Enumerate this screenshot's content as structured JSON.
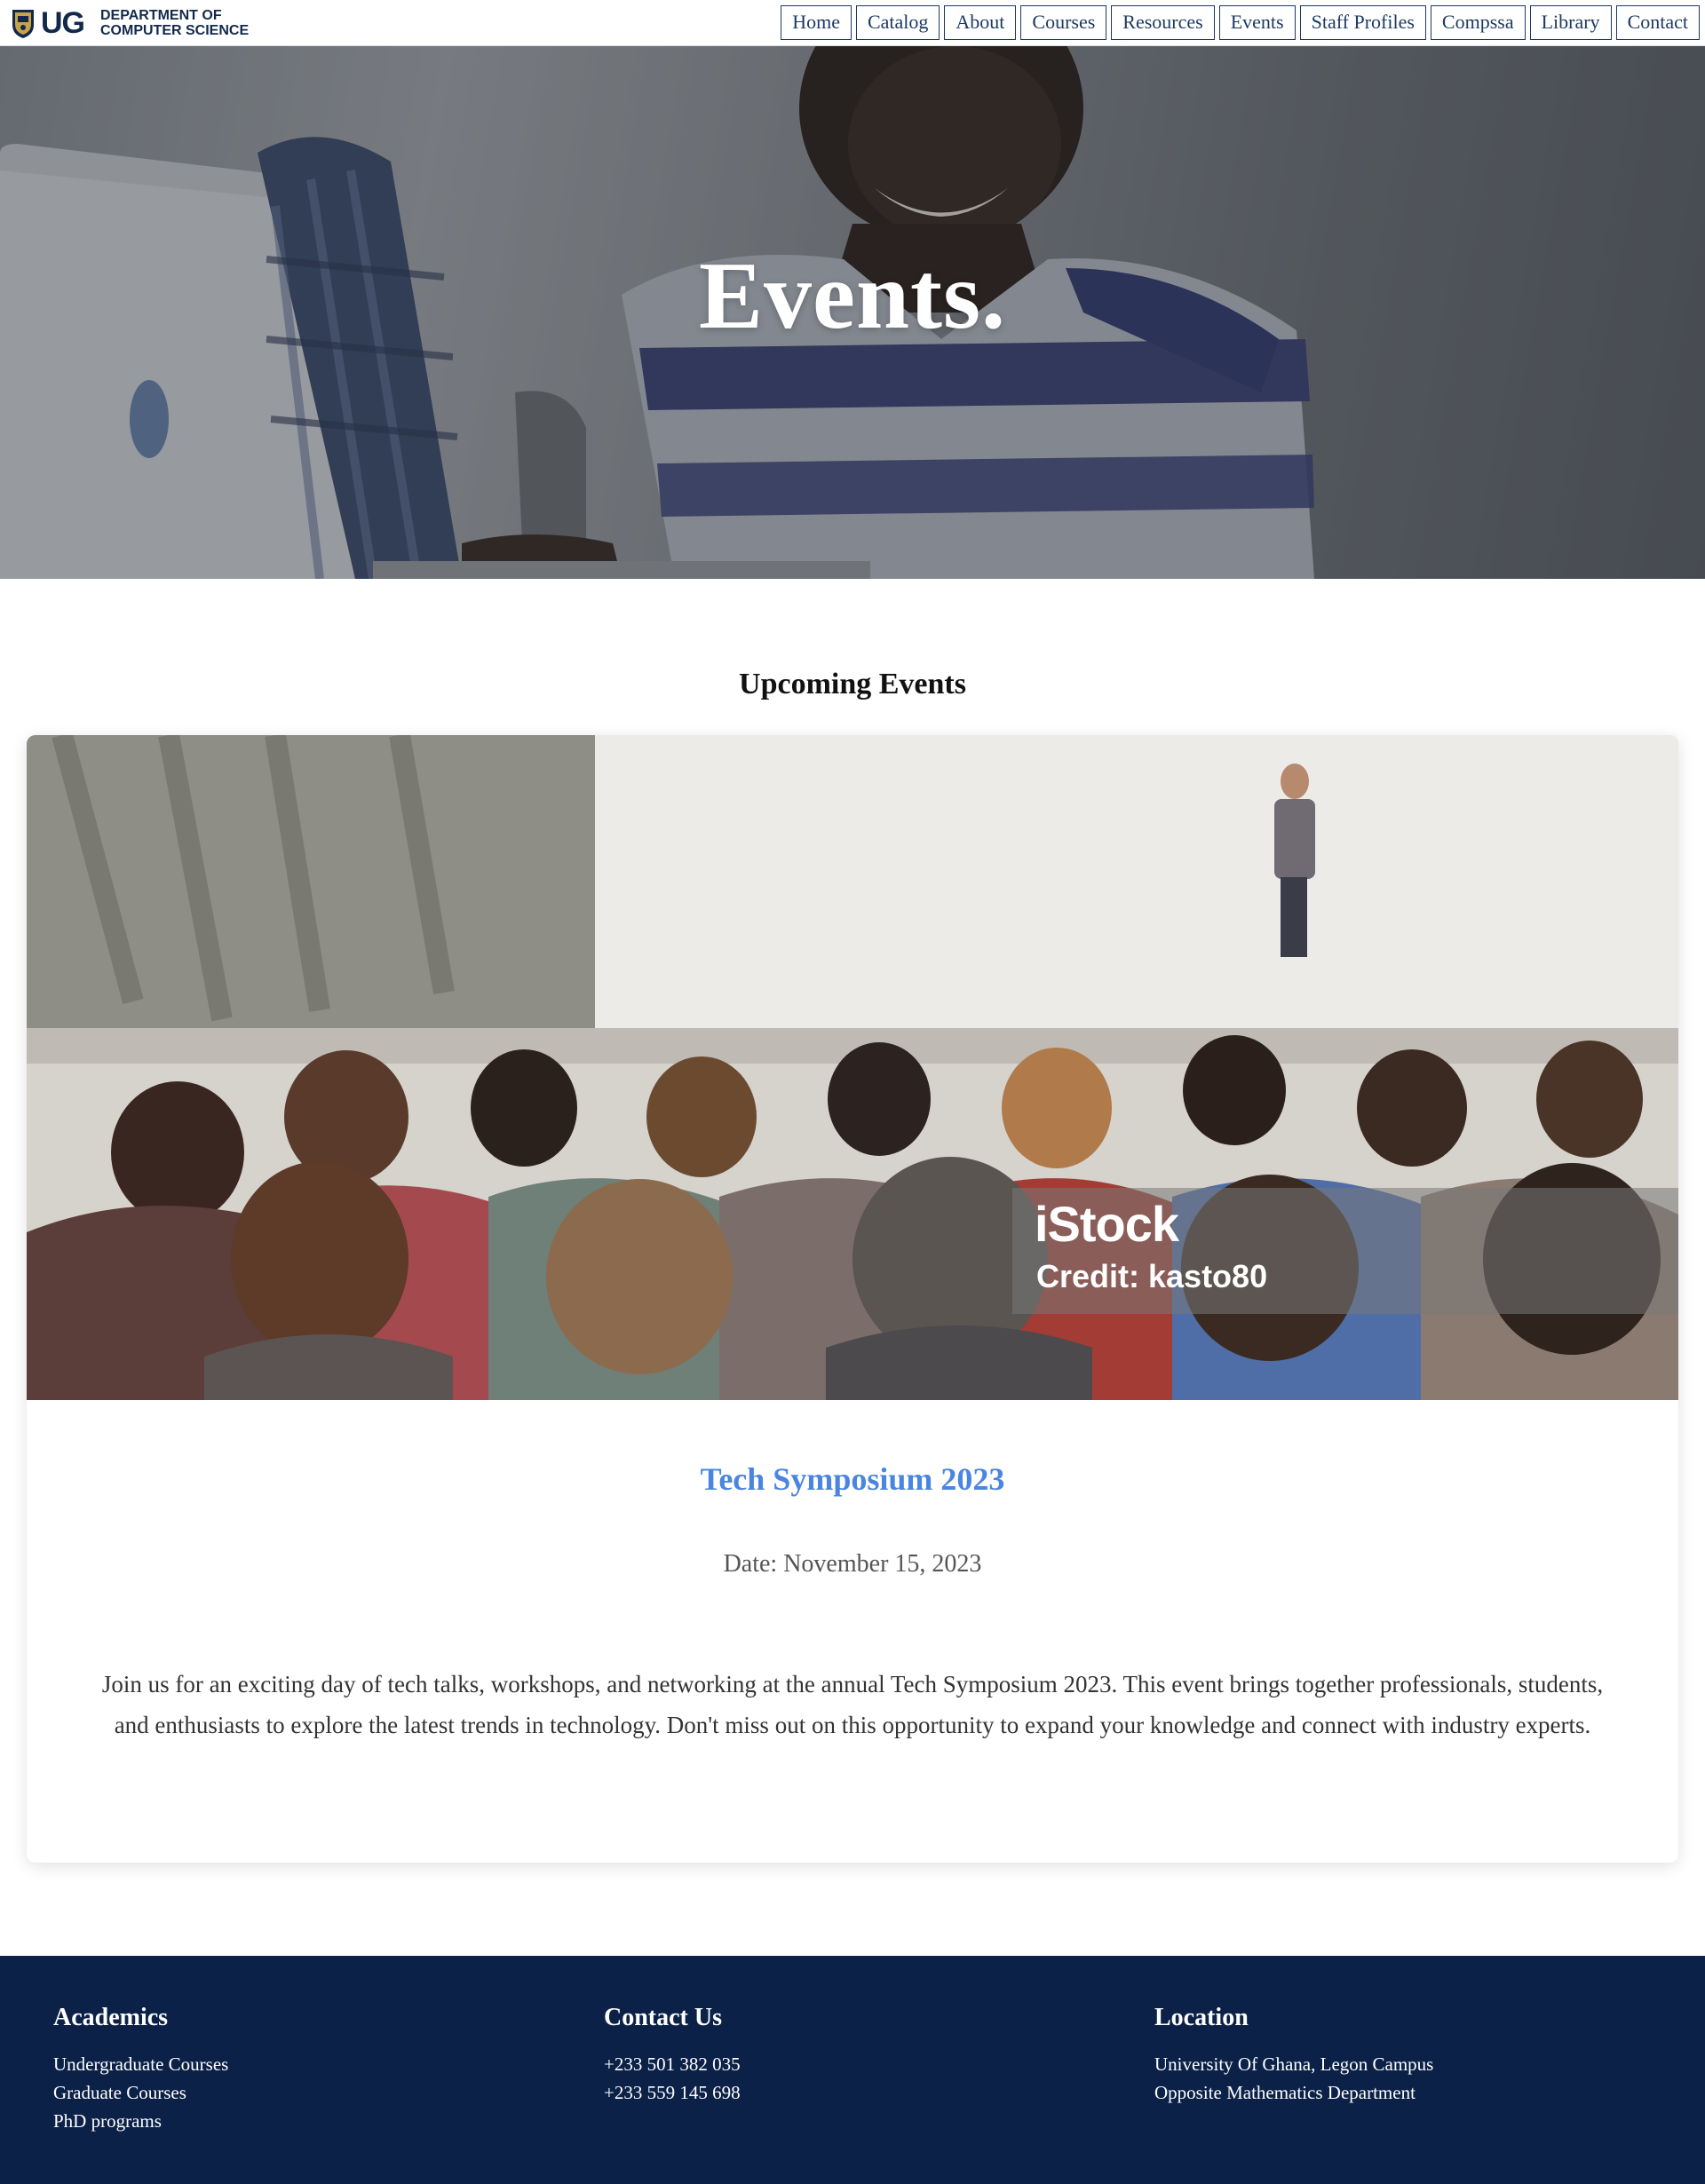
{
  "logo": {
    "short": "UG",
    "dept_line1": "DEPARTMENT OF",
    "dept_line2": "COMPUTER SCIENCE"
  },
  "nav": [
    {
      "label": "Home"
    },
    {
      "label": "Catalog"
    },
    {
      "label": "About"
    },
    {
      "label": "Courses"
    },
    {
      "label": "Resources"
    },
    {
      "label": "Events"
    },
    {
      "label": "Staff Profiles"
    },
    {
      "label": "Compssa"
    },
    {
      "label": "Library"
    },
    {
      "label": "Contact"
    }
  ],
  "hero": {
    "title": "Events."
  },
  "section": {
    "heading": "Upcoming Events"
  },
  "event": {
    "watermark_brand": "iStock",
    "watermark_credit": "Credit: kasto80",
    "title": "Tech Symposium 2023",
    "date": "Date: November 15, 2023",
    "description": "Join us for an exciting day of tech talks, workshops, and networking at the annual Tech Symposium 2023. This event brings together professionals, students, and enthusiasts to explore the latest trends in technology. Don't miss out on this opportunity to expand your knowledge and connect with industry experts."
  },
  "footer": {
    "academics": {
      "heading": "Academics",
      "items": [
        "Undergraduate Courses",
        "Graduate Courses",
        "PhD programs"
      ]
    },
    "contact": {
      "heading": "Contact Us",
      "items": [
        "+233 501 382 035",
        "+233 559 145 698"
      ]
    },
    "location": {
      "heading": "Location",
      "items": [
        "University Of Ghana, Legon Campus",
        "Opposite Mathematics Department"
      ]
    }
  },
  "colors": {
    "brand_navy": "#13294b",
    "footer_bg": "#0c2148",
    "event_title": "#4a86e0"
  }
}
